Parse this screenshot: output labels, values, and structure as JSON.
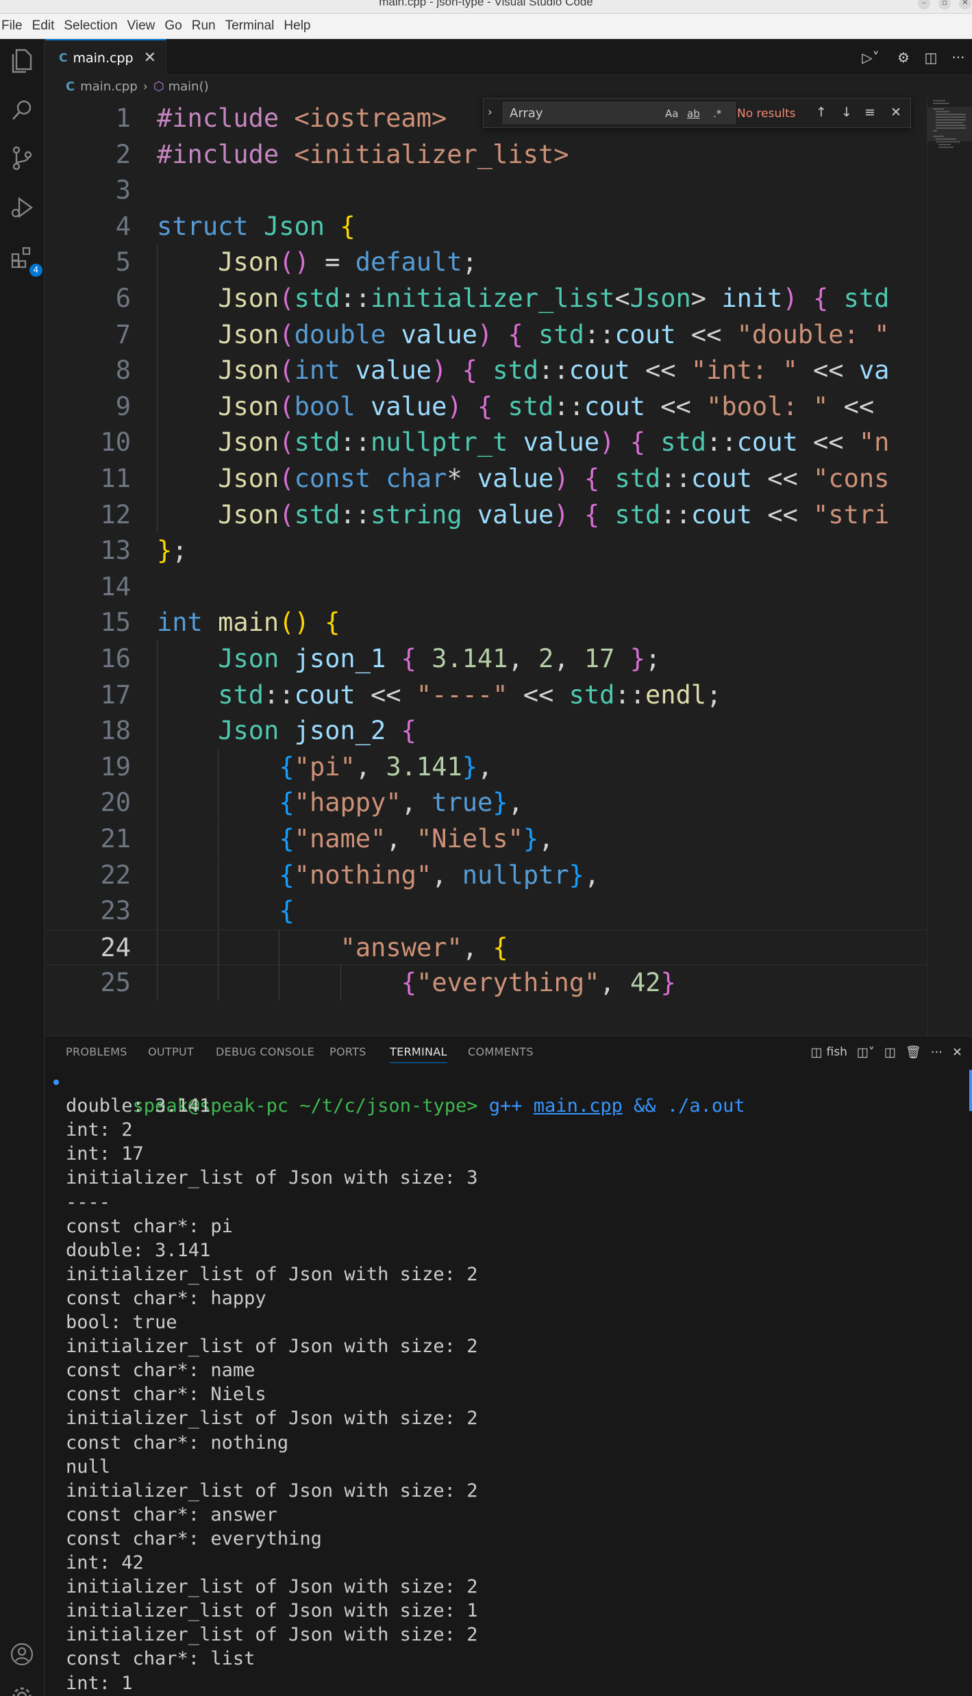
{
  "window": {
    "title": "main.cpp - json-type - Visual Studio Code"
  },
  "menu": [
    "File",
    "Edit",
    "Selection",
    "View",
    "Go",
    "Run",
    "Terminal",
    "Help"
  ],
  "activity": {
    "extensions_badge": "4"
  },
  "tab": {
    "label": "main.cpp"
  },
  "breadcrumb": {
    "file": "main.cpp",
    "symbol": "main()"
  },
  "find": {
    "value": "Array",
    "opt_case": "Aa",
    "opt_word": "ab",
    "opt_regex": ".*",
    "result": "No results"
  },
  "editor": {
    "current_line": 24,
    "lines": [
      {
        "n": "1",
        "indent": 0,
        "tokens": [
          [
            "p",
            "#include"
          ],
          [
            "w",
            " "
          ],
          [
            "s",
            "<iostream>"
          ]
        ]
      },
      {
        "n": "2",
        "indent": 0,
        "tokens": [
          [
            "p",
            "#include"
          ],
          [
            "w",
            " "
          ],
          [
            "s",
            "<initializer_list>"
          ]
        ]
      },
      {
        "n": "3",
        "indent": 0,
        "tokens": []
      },
      {
        "n": "4",
        "indent": 0,
        "tokens": [
          [
            "k",
            "struct"
          ],
          [
            "w",
            " "
          ],
          [
            "t",
            "Json"
          ],
          [
            "w",
            " "
          ],
          [
            "b1",
            "{"
          ]
        ]
      },
      {
        "n": "5",
        "indent": 1,
        "tokens": [
          [
            "f",
            "Json"
          ],
          [
            "b2",
            "()"
          ],
          [
            "w",
            " = "
          ],
          [
            "k",
            "default"
          ],
          [
            "w",
            ";"
          ]
        ]
      },
      {
        "n": "6",
        "indent": 1,
        "tokens": [
          [
            "f",
            "Json"
          ],
          [
            "b2",
            "("
          ],
          [
            "t",
            "std"
          ],
          [
            "w",
            "::"
          ],
          [
            "t",
            "initializer_list"
          ],
          [
            "w",
            "<"
          ],
          [
            "t",
            "Json"
          ],
          [
            "w",
            "> "
          ],
          [
            "v",
            "init"
          ],
          [
            "b2",
            ")"
          ],
          [
            "w",
            " "
          ],
          [
            "b2",
            "{"
          ],
          [
            "w",
            " "
          ],
          [
            "t",
            "std"
          ]
        ]
      },
      {
        "n": "7",
        "indent": 1,
        "tokens": [
          [
            "f",
            "Json"
          ],
          [
            "b2",
            "("
          ],
          [
            "k",
            "double"
          ],
          [
            "w",
            " "
          ],
          [
            "v",
            "value"
          ],
          [
            "b2",
            ")"
          ],
          [
            "w",
            " "
          ],
          [
            "b2",
            "{"
          ],
          [
            "w",
            " "
          ],
          [
            "t",
            "std"
          ],
          [
            "w",
            "::"
          ],
          [
            "v",
            "cout"
          ],
          [
            "w",
            " << "
          ],
          [
            "s",
            "\"double: \""
          ]
        ]
      },
      {
        "n": "8",
        "indent": 1,
        "tokens": [
          [
            "f",
            "Json"
          ],
          [
            "b2",
            "("
          ],
          [
            "k",
            "int"
          ],
          [
            "w",
            " "
          ],
          [
            "v",
            "value"
          ],
          [
            "b2",
            ")"
          ],
          [
            "w",
            " "
          ],
          [
            "b2",
            "{"
          ],
          [
            "w",
            " "
          ],
          [
            "t",
            "std"
          ],
          [
            "w",
            "::"
          ],
          [
            "v",
            "cout"
          ],
          [
            "w",
            " << "
          ],
          [
            "s",
            "\"int: \""
          ],
          [
            "w",
            " << "
          ],
          [
            "v",
            "va"
          ]
        ]
      },
      {
        "n": "9",
        "indent": 1,
        "tokens": [
          [
            "f",
            "Json"
          ],
          [
            "b2",
            "("
          ],
          [
            "k",
            "bool"
          ],
          [
            "w",
            " "
          ],
          [
            "v",
            "value"
          ],
          [
            "b2",
            ")"
          ],
          [
            "w",
            " "
          ],
          [
            "b2",
            "{"
          ],
          [
            "w",
            " "
          ],
          [
            "t",
            "std"
          ],
          [
            "w",
            "::"
          ],
          [
            "v",
            "cout"
          ],
          [
            "w",
            " << "
          ],
          [
            "s",
            "\"bool: \""
          ],
          [
            "w",
            " <<"
          ]
        ]
      },
      {
        "n": "10",
        "indent": 1,
        "tokens": [
          [
            "f",
            "Json"
          ],
          [
            "b2",
            "("
          ],
          [
            "t",
            "std"
          ],
          [
            "w",
            "::"
          ],
          [
            "t",
            "nullptr_t"
          ],
          [
            "w",
            " "
          ],
          [
            "v",
            "value"
          ],
          [
            "b2",
            ")"
          ],
          [
            "w",
            " "
          ],
          [
            "b2",
            "{"
          ],
          [
            "w",
            " "
          ],
          [
            "t",
            "std"
          ],
          [
            "w",
            "::"
          ],
          [
            "v",
            "cout"
          ],
          [
            "w",
            " << "
          ],
          [
            "s",
            "\"n"
          ]
        ]
      },
      {
        "n": "11",
        "indent": 1,
        "tokens": [
          [
            "f",
            "Json"
          ],
          [
            "b2",
            "("
          ],
          [
            "k",
            "const"
          ],
          [
            "w",
            " "
          ],
          [
            "k",
            "char"
          ],
          [
            "w",
            "* "
          ],
          [
            "v",
            "value"
          ],
          [
            "b2",
            ")"
          ],
          [
            "w",
            " "
          ],
          [
            "b2",
            "{"
          ],
          [
            "w",
            " "
          ],
          [
            "t",
            "std"
          ],
          [
            "w",
            "::"
          ],
          [
            "v",
            "cout"
          ],
          [
            "w",
            " << "
          ],
          [
            "s",
            "\"cons"
          ]
        ]
      },
      {
        "n": "12",
        "indent": 1,
        "tokens": [
          [
            "f",
            "Json"
          ],
          [
            "b2",
            "("
          ],
          [
            "t",
            "std"
          ],
          [
            "w",
            "::"
          ],
          [
            "t",
            "string"
          ],
          [
            "w",
            " "
          ],
          [
            "v",
            "value"
          ],
          [
            "b2",
            ")"
          ],
          [
            "w",
            " "
          ],
          [
            "b2",
            "{"
          ],
          [
            "w",
            " "
          ],
          [
            "t",
            "std"
          ],
          [
            "w",
            "::"
          ],
          [
            "v",
            "cout"
          ],
          [
            "w",
            " << "
          ],
          [
            "s",
            "\"stri"
          ]
        ]
      },
      {
        "n": "13",
        "indent": 0,
        "tokens": [
          [
            "b1",
            "}"
          ],
          [
            "w",
            ";"
          ]
        ]
      },
      {
        "n": "14",
        "indent": 0,
        "tokens": []
      },
      {
        "n": "15",
        "indent": 0,
        "tokens": [
          [
            "k",
            "int"
          ],
          [
            "w",
            " "
          ],
          [
            "f",
            "main"
          ],
          [
            "b1",
            "()"
          ],
          [
            "w",
            " "
          ],
          [
            "b1",
            "{"
          ]
        ]
      },
      {
        "n": "16",
        "indent": 1,
        "tokens": [
          [
            "t",
            "Json"
          ],
          [
            "w",
            " "
          ],
          [
            "v",
            "json_1"
          ],
          [
            "w",
            " "
          ],
          [
            "b2",
            "{"
          ],
          [
            "w",
            " "
          ],
          [
            "n",
            "3.141"
          ],
          [
            "w",
            ", "
          ],
          [
            "n",
            "2"
          ],
          [
            "w",
            ", "
          ],
          [
            "n",
            "17"
          ],
          [
            "w",
            " "
          ],
          [
            "b2",
            "}"
          ],
          [
            "w",
            ";"
          ]
        ]
      },
      {
        "n": "17",
        "indent": 1,
        "tokens": [
          [
            "t",
            "std"
          ],
          [
            "w",
            "::"
          ],
          [
            "v",
            "cout"
          ],
          [
            "w",
            " << "
          ],
          [
            "s",
            "\"----\""
          ],
          [
            "w",
            " << "
          ],
          [
            "t",
            "std"
          ],
          [
            "w",
            "::"
          ],
          [
            "f",
            "endl"
          ],
          [
            "w",
            ";"
          ]
        ]
      },
      {
        "n": "18",
        "indent": 1,
        "tokens": [
          [
            "t",
            "Json"
          ],
          [
            "w",
            " "
          ],
          [
            "v",
            "json_2"
          ],
          [
            "w",
            " "
          ],
          [
            "b2",
            "{"
          ]
        ]
      },
      {
        "n": "19",
        "indent": 2,
        "tokens": [
          [
            "b3",
            "{"
          ],
          [
            "s",
            "\"pi\""
          ],
          [
            "w",
            ", "
          ],
          [
            "n",
            "3.141"
          ],
          [
            "b3",
            "}"
          ],
          [
            "w",
            ","
          ]
        ]
      },
      {
        "n": "20",
        "indent": 2,
        "tokens": [
          [
            "b3",
            "{"
          ],
          [
            "s",
            "\"happy\""
          ],
          [
            "w",
            ", "
          ],
          [
            "k",
            "true"
          ],
          [
            "b3",
            "}"
          ],
          [
            "w",
            ","
          ]
        ]
      },
      {
        "n": "21",
        "indent": 2,
        "tokens": [
          [
            "b3",
            "{"
          ],
          [
            "s",
            "\"name\""
          ],
          [
            "w",
            ", "
          ],
          [
            "s",
            "\"Niels\""
          ],
          [
            "b3",
            "}"
          ],
          [
            "w",
            ","
          ]
        ]
      },
      {
        "n": "22",
        "indent": 2,
        "tokens": [
          [
            "b3",
            "{"
          ],
          [
            "s",
            "\"nothing\""
          ],
          [
            "w",
            ", "
          ],
          [
            "k",
            "nullptr"
          ],
          [
            "b3",
            "}"
          ],
          [
            "w",
            ","
          ]
        ]
      },
      {
        "n": "23",
        "indent": 2,
        "tokens": [
          [
            "b3",
            "{"
          ]
        ]
      },
      {
        "n": "24",
        "indent": 3,
        "tokens": [
          [
            "s",
            "\"answer\""
          ],
          [
            "w",
            ", "
          ],
          [
            "b1",
            "{"
          ]
        ]
      },
      {
        "n": "25",
        "indent": 4,
        "tokens": [
          [
            "b2",
            "{"
          ],
          [
            "s",
            "\"everything\""
          ],
          [
            "w",
            ", "
          ],
          [
            "n",
            "42"
          ],
          [
            "b2",
            "}"
          ]
        ]
      }
    ]
  },
  "panel": {
    "tabs": [
      "PROBLEMS",
      "OUTPUT",
      "DEBUG CONSOLE",
      "PORTS",
      "TERMINAL",
      "COMMENTS"
    ],
    "active_tab": "TERMINAL",
    "shell": "fish"
  },
  "terminal": {
    "prompt_user": "speak@speak-pc",
    "prompt_path": "~/t/c/json-type>",
    "prompt_cmd": "g++",
    "prompt_arg": "main.cpp",
    "prompt_rest": "&& ./a.out",
    "output": [
      "double: 3.141",
      "int: 2",
      "int: 17",
      "initializer_list of Json with size: 3",
      "----",
      "const char*: pi",
      "double: 3.141",
      "initializer_list of Json with size: 2",
      "const char*: happy",
      "bool: true",
      "initializer_list of Json with size: 2",
      "const char*: name",
      "const char*: Niels",
      "initializer_list of Json with size: 2",
      "const char*: nothing",
      "null",
      "initializer_list of Json with size: 2",
      "const char*: answer",
      "const char*: everything",
      "int: 42",
      "initializer_list of Json with size: 2",
      "initializer_list of Json with size: 1",
      "initializer_list of Json with size: 2",
      "const char*: list",
      "int: 1"
    ]
  }
}
